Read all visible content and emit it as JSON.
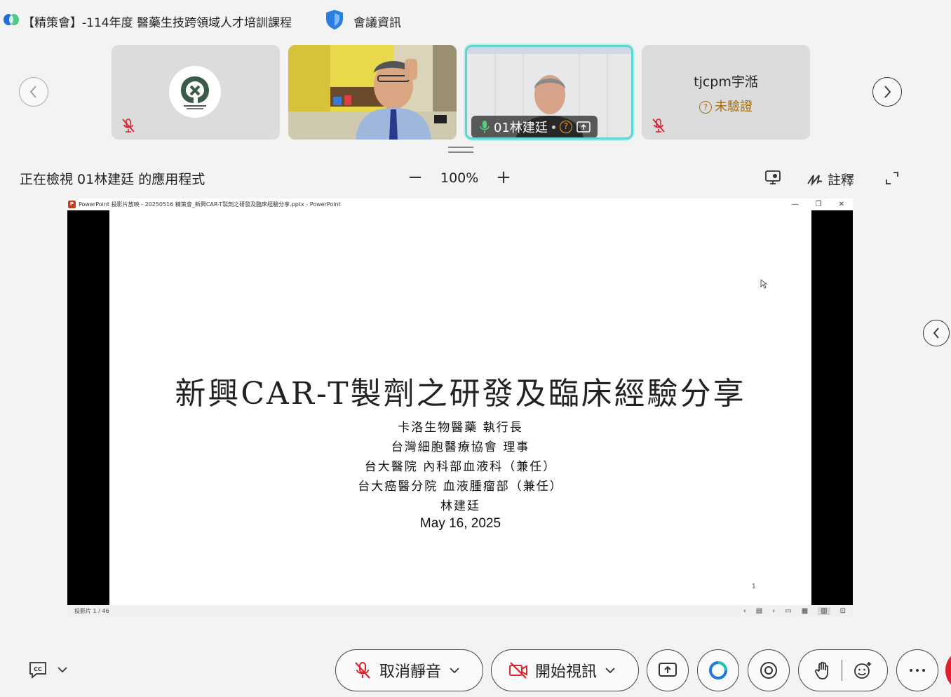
{
  "titlebar": {
    "meeting_title": "【精策會】-114年度 醫藥生技跨領域人才培訓課程",
    "meeting_info_label": "會議資訊"
  },
  "participants": {
    "tile4_name": "tjcpm宇湉",
    "tile4_status": "未驗證",
    "tile3_name": "01林建廷"
  },
  "view_toolbar": {
    "viewing_text": "正在檢視 01林建廷 的應用程式",
    "zoom_minus": "−",
    "zoom_value": "100%",
    "zoom_plus": "+",
    "annotate_label": "註釋"
  },
  "ppt": {
    "window_title": "PowerPoint 投影片放映  -  20250516 精策會_新興CAR-T製劑之研發及臨床經驗分享.pptx - PowerPoint",
    "status_slide": "投影片 1 / 46",
    "slide": {
      "title": "新興CAR-T製劑之研發及臨床經驗分享",
      "lines": [
        "卡洛生物醫藥 執行長",
        "台灣細胞醫療協會 理事",
        "台大醫院 內科部血液科（兼任）",
        "台大癌醫分院 血液腫瘤部（兼任）",
        "林建廷"
      ],
      "date": "May 16, 2025",
      "number": "1"
    }
  },
  "controls": {
    "unmute_label": "取消靜音",
    "video_label": "開始視訊"
  },
  "colors": {
    "active_speaker_border": "#5ed6cf",
    "mute_red": "#d9232f",
    "unverified": "#a56d15",
    "leave_red": "#e0202f"
  }
}
